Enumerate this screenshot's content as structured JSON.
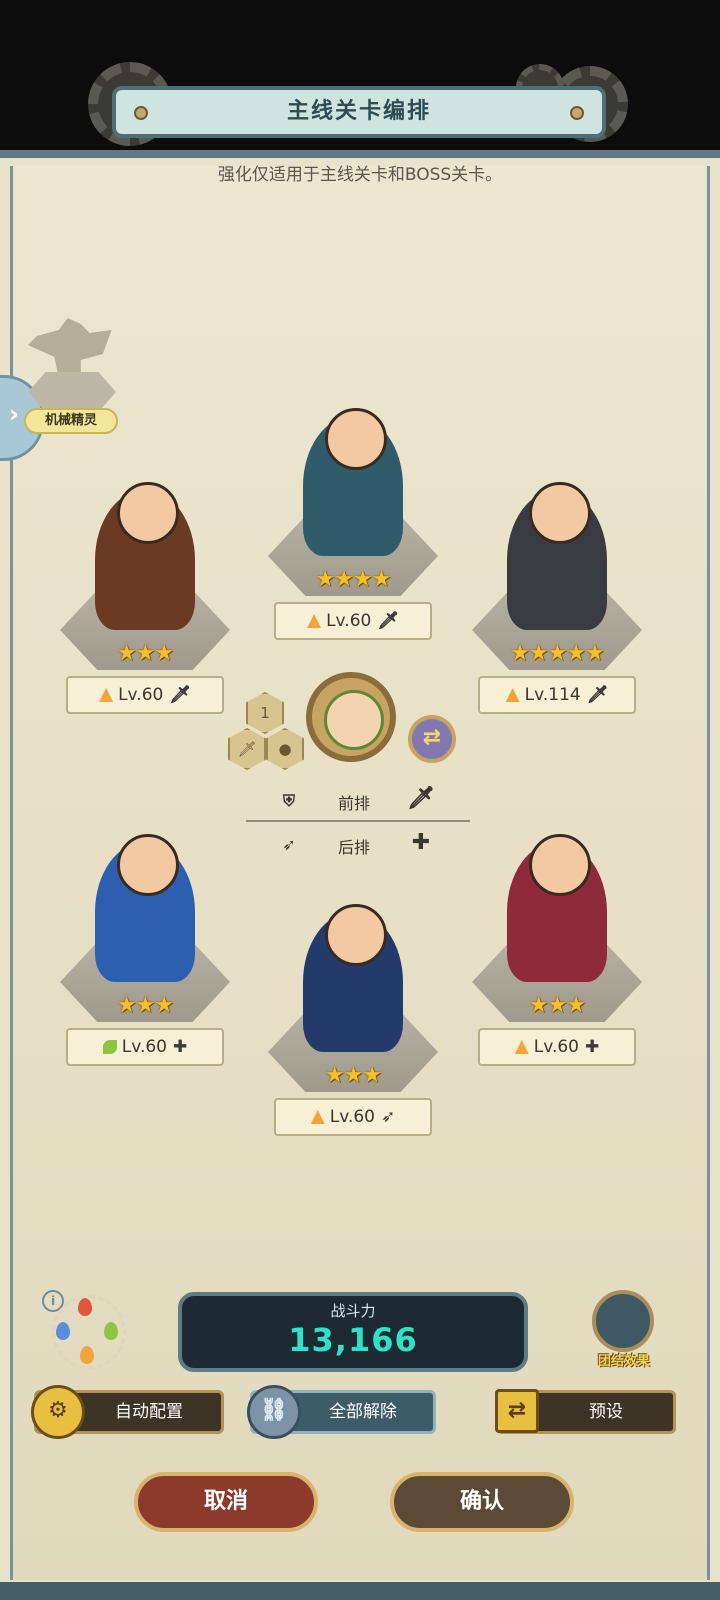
{
  "header": {
    "title": "主线关卡编排",
    "subtitle": "强化仅适用于主线关卡和BOSS关卡。"
  },
  "spirit": {
    "label": "机械精灵"
  },
  "leader": {
    "level_badge": "1"
  },
  "rows": {
    "front": {
      "label": "前排"
    },
    "back": {
      "label": "后排"
    }
  },
  "heroes": [
    {
      "id": "top-center",
      "stars": "★★★★",
      "level": "Lv.60",
      "element": "fire",
      "role_icon": "sword-icon"
    },
    {
      "id": "left",
      "stars": "★★★",
      "level": "Lv.60",
      "element": "fire",
      "role_icon": "sword-icon"
    },
    {
      "id": "right",
      "stars": "★★★★★",
      "level": "Lv.114",
      "element": "fire",
      "role_icon": "sword-icon"
    },
    {
      "id": "bottom-left",
      "stars": "★★★",
      "level": "Lv.60",
      "element": "wind",
      "role_icon": "plus-icon"
    },
    {
      "id": "bottom-center",
      "stars": "★★★",
      "level": "Lv.60",
      "element": "fire",
      "role_icon": "bow-icon"
    },
    {
      "id": "bottom-right",
      "stars": "★★★",
      "level": "Lv.60",
      "element": "fire",
      "role_icon": "plus-icon"
    }
  ],
  "power": {
    "label": "战斗力",
    "value": "13,166"
  },
  "unity": {
    "label": "团结效果"
  },
  "buttons": {
    "auto": "自动配置",
    "clear": "全部解除",
    "preset": "预设",
    "cancel": "取消",
    "confirm": "确认"
  },
  "colors": {
    "fire": "#f1a43a",
    "wind": "#8cc63f",
    "water": "#5a8fe0",
    "accent": "#2ee2c9"
  }
}
